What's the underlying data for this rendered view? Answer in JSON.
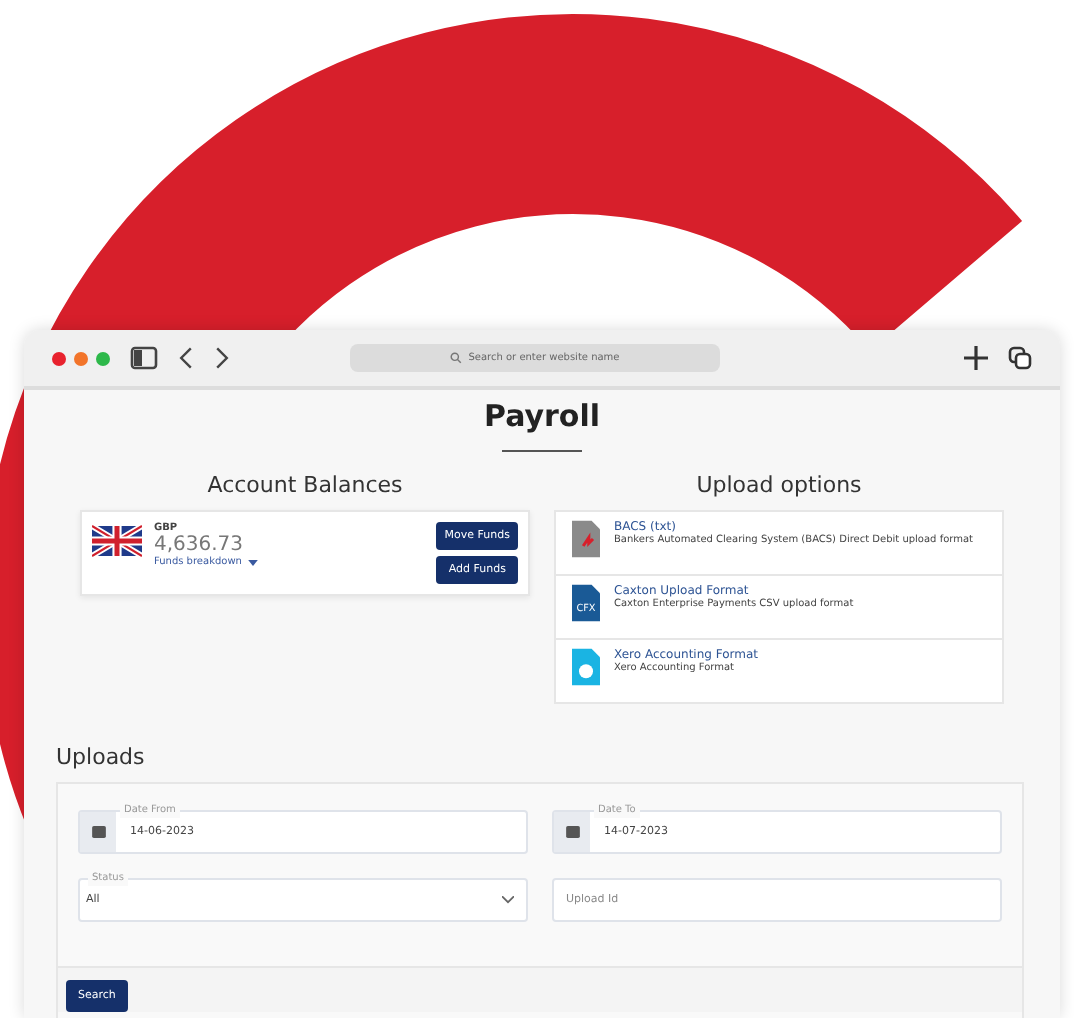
{
  "browser": {
    "address_placeholder": "Search or enter website name"
  },
  "page_title": "Payroll",
  "account_balances": {
    "title": "Account Balances",
    "accounts": [
      {
        "currency": "GBP",
        "amount": "4,636.73",
        "breakdown_link": "Funds breakdown",
        "buttons": [
          "Move Funds",
          "Add Funds"
        ]
      }
    ]
  },
  "upload_options": {
    "title": "Upload options",
    "items": [
      {
        "kind": "bacs",
        "name": "BACS (txt)",
        "description": "Bankers Automated Clearing System (BACS) Direct Debit upload format"
      },
      {
        "kind": "caxton",
        "name": "Caxton Upload Format",
        "description": "Caxton Enterprise Payments CSV upload format",
        "icon_text": "CFX"
      },
      {
        "kind": "xero",
        "name": "Xero Accounting Format",
        "description": "Xero Accounting Format"
      }
    ]
  },
  "uploads": {
    "title": "Uploads",
    "filters": [
      {
        "kind": "date",
        "label": "Date From",
        "value": "14-06-2023"
      },
      {
        "kind": "date",
        "label": "Date To",
        "value": "14-07-2023"
      },
      {
        "kind": "select",
        "label": "Status",
        "value": "All"
      },
      {
        "kind": "text",
        "placeholder": "Upload Id"
      }
    ],
    "search_button": "Search"
  }
}
